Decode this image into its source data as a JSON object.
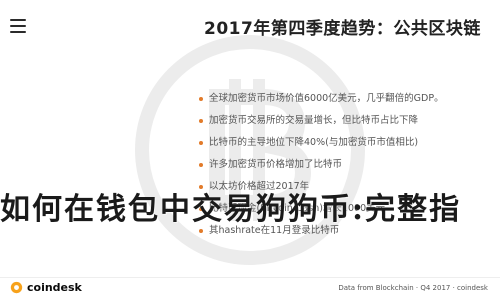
{
  "header": {
    "title": "2017年第四季度趋势：公共区块链"
  },
  "list": [
    "全球加密货币市场价值6000亿美元，几乎翻倍的GDP。",
    "加密货币交易所的交易量增长，但比特币占比下降",
    "比特币的主导地位下降40%(与加密货币市值相比)",
    "许多加密货币价格增加了比特币",
    "以太坊价格超过2017年",
    "比特币现金(Bitcoin Cash)增长1000美元",
    "其hashrate在11月登录比特币"
  ],
  "overlay": {
    "text": "如何在钱包中交易狗狗币:完整指"
  },
  "footer": {
    "brand": "coindesk",
    "source": "Data from Blockchain · Q4 2017 · coindesk"
  },
  "colors": {
    "bullet": "#e27b2a",
    "arrow": "#e27b2a",
    "watermark": "#e9e9e9"
  }
}
